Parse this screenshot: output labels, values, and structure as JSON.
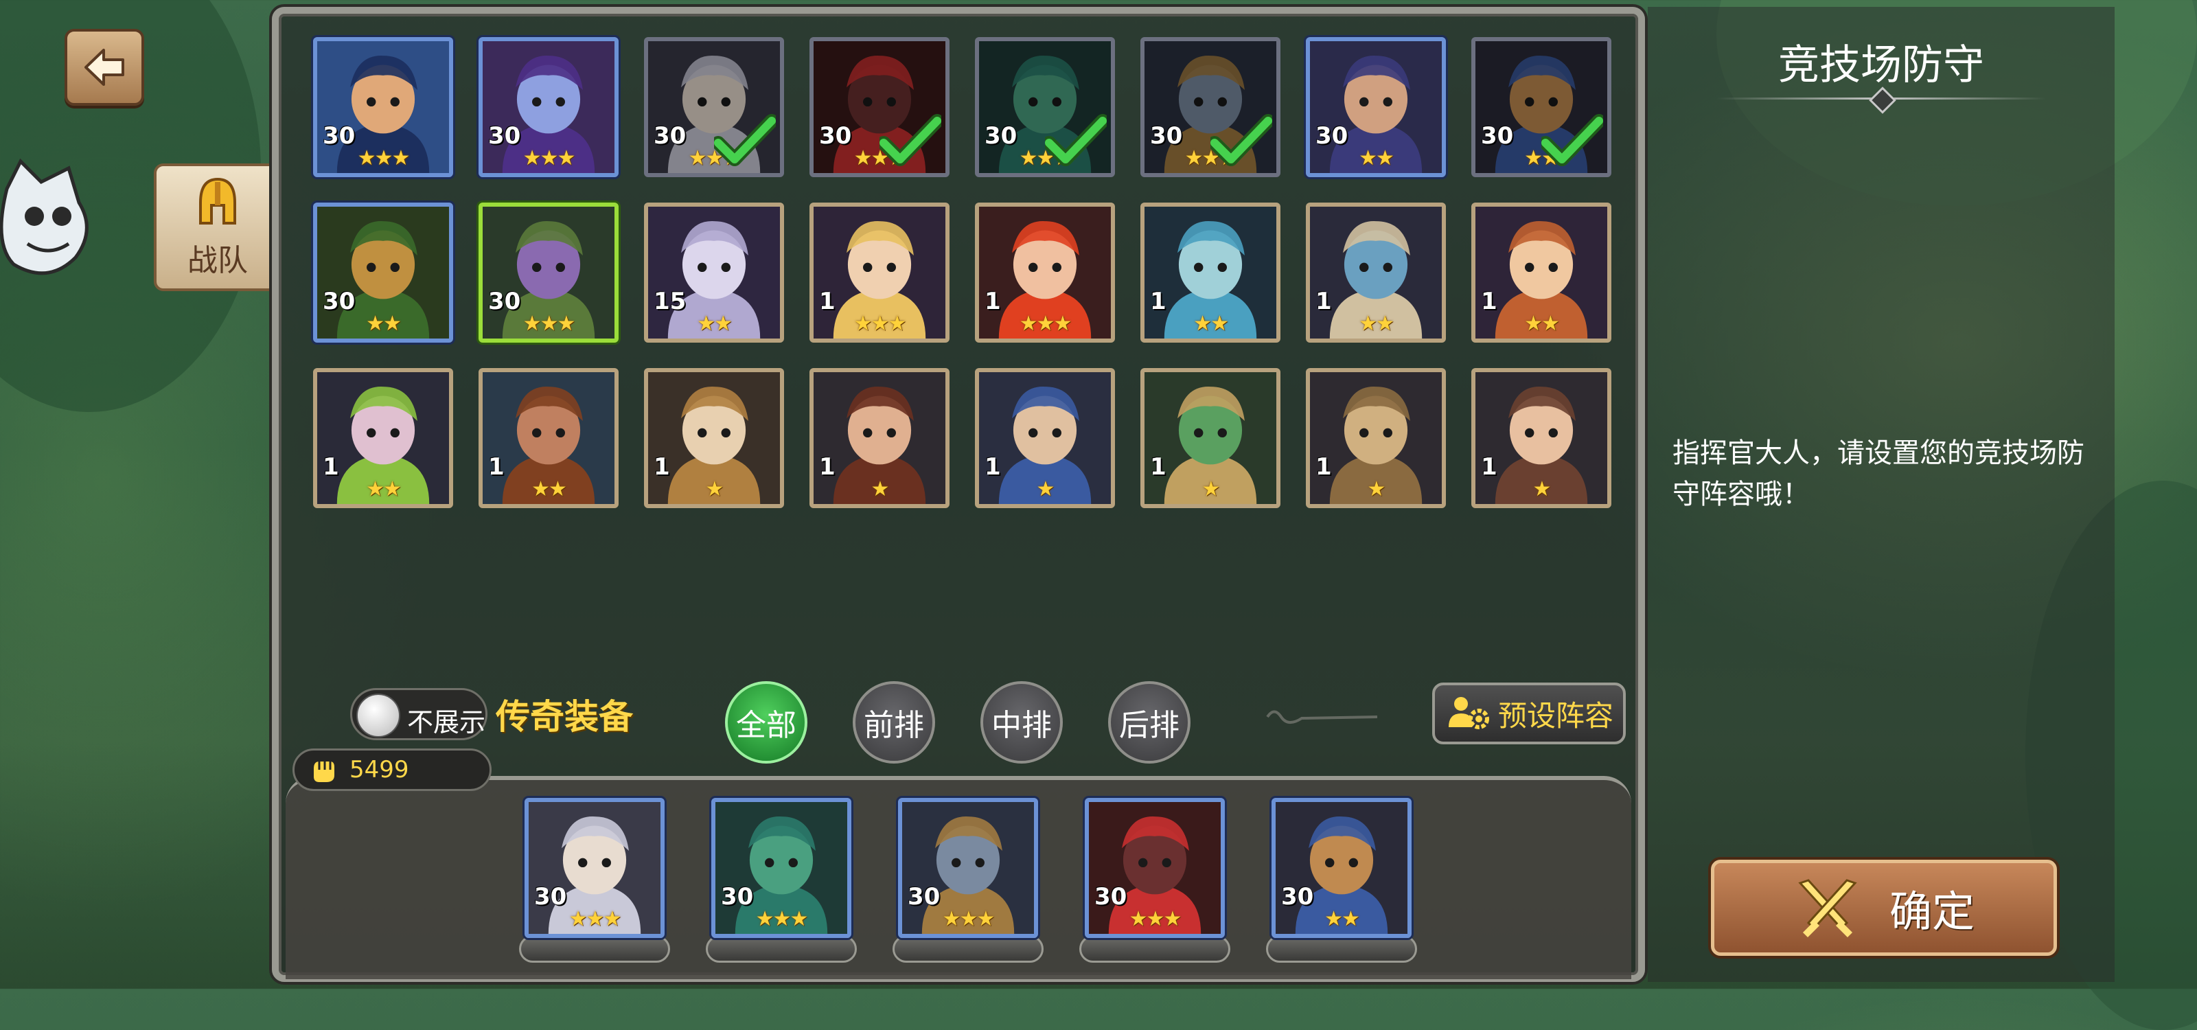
{
  "header": {
    "back_label": ""
  },
  "side_tab": {
    "label": "战队"
  },
  "roster": [
    {
      "level": "30",
      "stars": 3,
      "frame": "blue",
      "checked": false,
      "bg": "#2e4e86",
      "skin": "#e0a878",
      "accent": "#1c2f5e"
    },
    {
      "level": "30",
      "stars": 3,
      "frame": "blue",
      "checked": false,
      "bg": "#3c2a5a",
      "skin": "#8ea0e0",
      "accent": "#4c2f86"
    },
    {
      "level": "30",
      "stars": 3,
      "frame": "gray",
      "checked": true,
      "bg": "#3a3a48",
      "skin": "#e8dcd0",
      "accent": "#c9c9d8"
    },
    {
      "level": "30",
      "stars": 3,
      "frame": "gray",
      "checked": true,
      "bg": "#3a1a1a",
      "skin": "#6a3030",
      "accent": "#c83030"
    },
    {
      "level": "30",
      "stars": 3,
      "frame": "gray",
      "checked": true,
      "bg": "#1e3a36",
      "skin": "#4aa080",
      "accent": "#2a7a6a"
    },
    {
      "level": "30",
      "stars": 3,
      "frame": "gray",
      "checked": true,
      "bg": "#2a3040",
      "skin": "#7a8aa0",
      "accent": "#a07a40"
    },
    {
      "level": "30",
      "stars": 2,
      "frame": "blue",
      "checked": false,
      "bg": "#2a2a4a",
      "skin": "#d0a080",
      "accent": "#3a3a7a"
    },
    {
      "level": "30",
      "stars": 2,
      "frame": "gray",
      "checked": true,
      "bg": "#2a2a38",
      "skin": "#c08a50",
      "accent": "#3a5aa0"
    },
    {
      "level": "30",
      "stars": 2,
      "frame": "blue",
      "checked": false,
      "bg": "#2a3a1e",
      "skin": "#c09040",
      "accent": "#3a6a2a"
    },
    {
      "level": "30",
      "stars": 3,
      "frame": "green",
      "checked": false,
      "bg": "#2a3a2a",
      "skin": "#8a6ab0",
      "accent": "#5a7a3a"
    },
    {
      "level": "15",
      "stars": 2,
      "frame": "normal",
      "checked": false,
      "bg": "#2e2640",
      "skin": "#dcd6ec",
      "accent": "#b0a8d0"
    },
    {
      "level": "1",
      "stars": 3,
      "frame": "normal",
      "checked": false,
      "bg": "#2e2438",
      "skin": "#f0d0b0",
      "accent": "#e8c060"
    },
    {
      "level": "1",
      "stars": 3,
      "frame": "normal",
      "checked": false,
      "bg": "#3a1e1e",
      "skin": "#f0c0a0",
      "accent": "#e04020"
    },
    {
      "level": "1",
      "stars": 2,
      "frame": "normal",
      "checked": false,
      "bg": "#1e2e3a",
      "skin": "#a0d0d8",
      "accent": "#4aa0c0"
    },
    {
      "level": "1",
      "stars": 2,
      "frame": "normal",
      "checked": false,
      "bg": "#2a2a3a",
      "skin": "#6aa0c0",
      "accent": "#d0c0a0"
    },
    {
      "level": "1",
      "stars": 2,
      "frame": "normal",
      "checked": false,
      "bg": "#2e2438",
      "skin": "#f0c8a0",
      "accent": "#c06030"
    },
    {
      "level": "1",
      "stars": 2,
      "frame": "normal",
      "checked": false,
      "bg": "#2a2a38",
      "skin": "#e0c0d0",
      "accent": "#8ac040"
    },
    {
      "level": "1",
      "stars": 2,
      "frame": "normal",
      "checked": false,
      "bg": "#2a3a4a",
      "skin": "#c08060",
      "accent": "#804020"
    },
    {
      "level": "1",
      "stars": 1,
      "frame": "normal",
      "checked": false,
      "bg": "#3a3028",
      "skin": "#e8d0b0",
      "accent": "#b08040"
    },
    {
      "level": "1",
      "stars": 1,
      "frame": "normal",
      "checked": false,
      "bg": "#2e2a30",
      "skin": "#e0b090",
      "accent": "#6a3020"
    },
    {
      "level": "1",
      "stars": 1,
      "frame": "normal",
      "checked": false,
      "bg": "#2a2e40",
      "skin": "#e0c0a0",
      "accent": "#3a5aa0"
    },
    {
      "level": "1",
      "stars": 1,
      "frame": "normal",
      "checked": false,
      "bg": "#2a3a2a",
      "skin": "#5aa060",
      "accent": "#c0a060"
    },
    {
      "level": "1",
      "stars": 1,
      "frame": "normal",
      "checked": false,
      "bg": "#2e2a30",
      "skin": "#d0b080",
      "accent": "#8a6a40"
    },
    {
      "level": "1",
      "stars": 1,
      "frame": "normal",
      "checked": false,
      "bg": "#2e2a30",
      "skin": "#e8c0a0",
      "accent": "#6a4030"
    }
  ],
  "filters": {
    "toggle_label": "不展示",
    "legend_label": "传奇装备",
    "tabs": [
      "全部",
      "前排",
      "中排",
      "后排"
    ],
    "active_tab": 0,
    "preset_label": "预设阵容"
  },
  "power": {
    "value": "5499"
  },
  "lineup": [
    {
      "level": "30",
      "stars": 3,
      "bg": "#3a3a48",
      "skin": "#e8dcd0",
      "accent": "#c9c9d8"
    },
    {
      "level": "30",
      "stars": 3,
      "bg": "#1e3a36",
      "skin": "#4aa080",
      "accent": "#2a7a6a"
    },
    {
      "level": "30",
      "stars": 3,
      "bg": "#2a3040",
      "skin": "#7a8aa0",
      "accent": "#a07a40"
    },
    {
      "level": "30",
      "stars": 3,
      "bg": "#3a1a1a",
      "skin": "#6a3030",
      "accent": "#c83030"
    },
    {
      "level": "30",
      "stars": 2,
      "bg": "#2a2a38",
      "skin": "#c08a50",
      "accent": "#3a5aa0"
    }
  ],
  "info": {
    "title": "竞技场防守",
    "message": "指挥官大人，请设置您的竞技场防守阵容哦！"
  },
  "confirm": {
    "label": "确定"
  },
  "colors": {
    "accent_gold": "#ffd84a",
    "active_green": "#157a26",
    "check_green": "#3ec24a"
  }
}
